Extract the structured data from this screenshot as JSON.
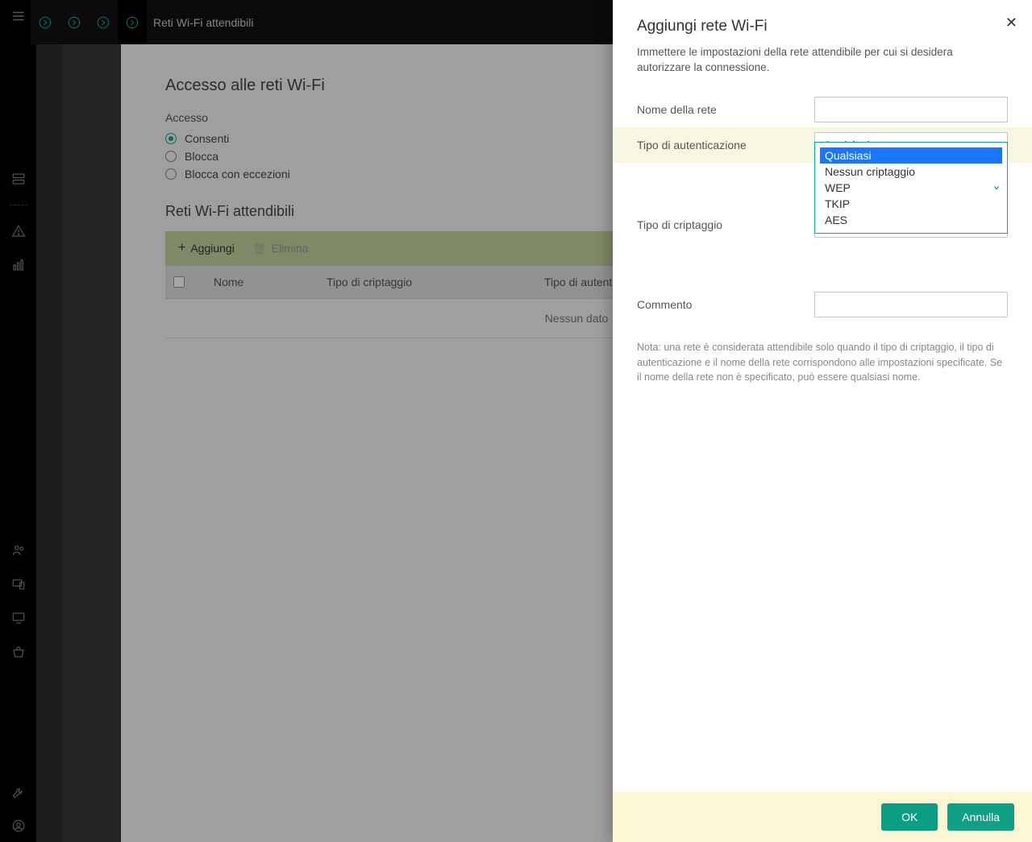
{
  "header": {
    "title": "Reti Wi-Fi attendibili"
  },
  "main": {
    "section_title": "Accesso alle reti Wi-Fi",
    "access_label": "Accesso",
    "radio_options": [
      "Consenti",
      "Blocca",
      "Blocca con eccezioni"
    ],
    "radio_selected_index": 0,
    "trusted_title": "Reti Wi-Fi attendibili",
    "toolbar": {
      "add": "Aggiungi",
      "delete": "Elimina"
    },
    "columns": [
      "Nome",
      "Tipo di criptaggio",
      "Tipo di autenticazione"
    ],
    "empty_text": "Nessun dato"
  },
  "panel": {
    "title": "Aggiungi rete Wi-Fi",
    "subtitle": "Immettere le impostazioni della rete attendibile per cui si desidera autorizzare la connessione.",
    "fields": {
      "network_name": {
        "label": "Nome della rete",
        "value": ""
      },
      "auth_type": {
        "label": "Tipo di autenticazione",
        "value": "Qualsiasi"
      },
      "enc_type": {
        "label": "Tipo di criptaggio",
        "value": ""
      },
      "comment": {
        "label": "Commento",
        "value": ""
      }
    },
    "dropdown_options": [
      "Qualsiasi",
      "Nessun criptaggio",
      "WEP",
      "TKIP",
      "AES"
    ],
    "dropdown_selected_index": 0,
    "note": "Nota: una rete è considerata attendibile solo quando il tipo di criptaggio, il tipo di autenticazione e il nome della rete corrispondono alle impostazioni specificate. Se il nome della rete non è specificato, può essere qualsiasi nome.",
    "buttons": {
      "ok": "OK",
      "cancel": "Annulla"
    }
  }
}
